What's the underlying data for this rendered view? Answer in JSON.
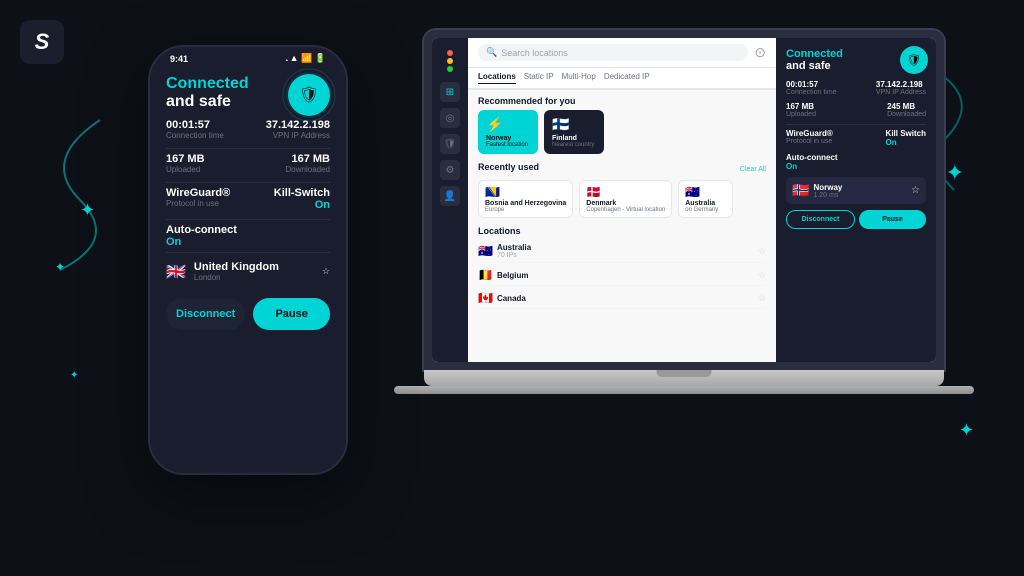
{
  "logo": {
    "symbol": "S",
    "alt": "Surfshark"
  },
  "phone": {
    "status_bar": {
      "time": "9:41",
      "signal": "▲▲▲",
      "wifi": "WiFi",
      "battery": "🔋"
    },
    "connection": {
      "title": "Connected",
      "subtitle": "and safe",
      "shield_icon": "🛡"
    },
    "stats": {
      "connection_time": "00:01:57",
      "connection_time_label": "Connection time",
      "ip_address": "37.142.2.198",
      "ip_label": "VPN IP Address",
      "uploaded": "167 MB",
      "uploaded_label": "Uploaded",
      "downloaded": "167 MB",
      "downloaded_label": "Downloaded",
      "protocol": "WireGuard®",
      "protocol_label": "Protocol in use",
      "kill_switch": "Kill-Switch",
      "kill_switch_value": "On",
      "auto_connect": "Auto-connect",
      "auto_connect_value": "On"
    },
    "location": {
      "flag": "🇬🇧",
      "country": "United Kingdom",
      "city": "London"
    },
    "buttons": {
      "disconnect": "Disconnect",
      "pause": "Pause"
    }
  },
  "laptop": {
    "window_dots": [
      "#ff5f56",
      "#ffbd2e",
      "#27c93f"
    ],
    "search_placeholder": "Search locations",
    "tabs": [
      "Locations",
      "Static IP",
      "Multi-Hop",
      "Dedicated IP"
    ],
    "recommended_title": "Recommended for you",
    "recommended": [
      {
        "flag": "⚡",
        "name": "Norway",
        "sub": "Fastest location"
      },
      {
        "flag": "🇫🇮",
        "name": "Finland",
        "sub": "Nearest country"
      }
    ],
    "recently_title": "Recently used",
    "clear_label": "Clear All",
    "recently_used": [
      {
        "flag": "🇧🇦",
        "name": "Bosnia and Herzegovina",
        "sub": "Europe"
      },
      {
        "flag": "🇩🇰",
        "name": "Denmark",
        "sub": "Copenhagen - Virtual location"
      },
      {
        "flag": "🇦🇺",
        "name": "Australia",
        "sub": "on Germany"
      }
    ],
    "locations_title": "Locations",
    "locations": [
      {
        "flag": "🇦🇺",
        "name": "Australia",
        "count": "70 IPs"
      },
      {
        "flag": "🇧🇪",
        "name": "Belgium",
        "count": ""
      },
      {
        "flag": "🇨🇦",
        "name": "Canada",
        "count": ""
      }
    ],
    "panel": {
      "title": "Connected",
      "subtitle": "and safe",
      "time": "00:01:57",
      "time_label": "Connection time",
      "ip": "37.142.2.198",
      "ip_label": "VPN IP Address",
      "uploaded": "167 MB",
      "uploaded_label": "Uploaded",
      "downloaded": "245 MB",
      "downloaded_label": "Downloaded",
      "protocol": "WireGuard®",
      "protocol_label": "Protocol in use",
      "kill_switch": "Kill Switch",
      "kill_switch_value": "On",
      "auto_connect": "Auto-connect",
      "auto_connect_value": "On",
      "location_flag": "🇳🇴",
      "location_name": "Norway",
      "location_sub": "1.20 ms",
      "disconnect_btn": "Disconnect",
      "pause_btn": "Pause"
    }
  },
  "decorations": {
    "stars": [
      "✦",
      "✦",
      "✦",
      "✦",
      "✦"
    ],
    "sparkle": "✦"
  }
}
